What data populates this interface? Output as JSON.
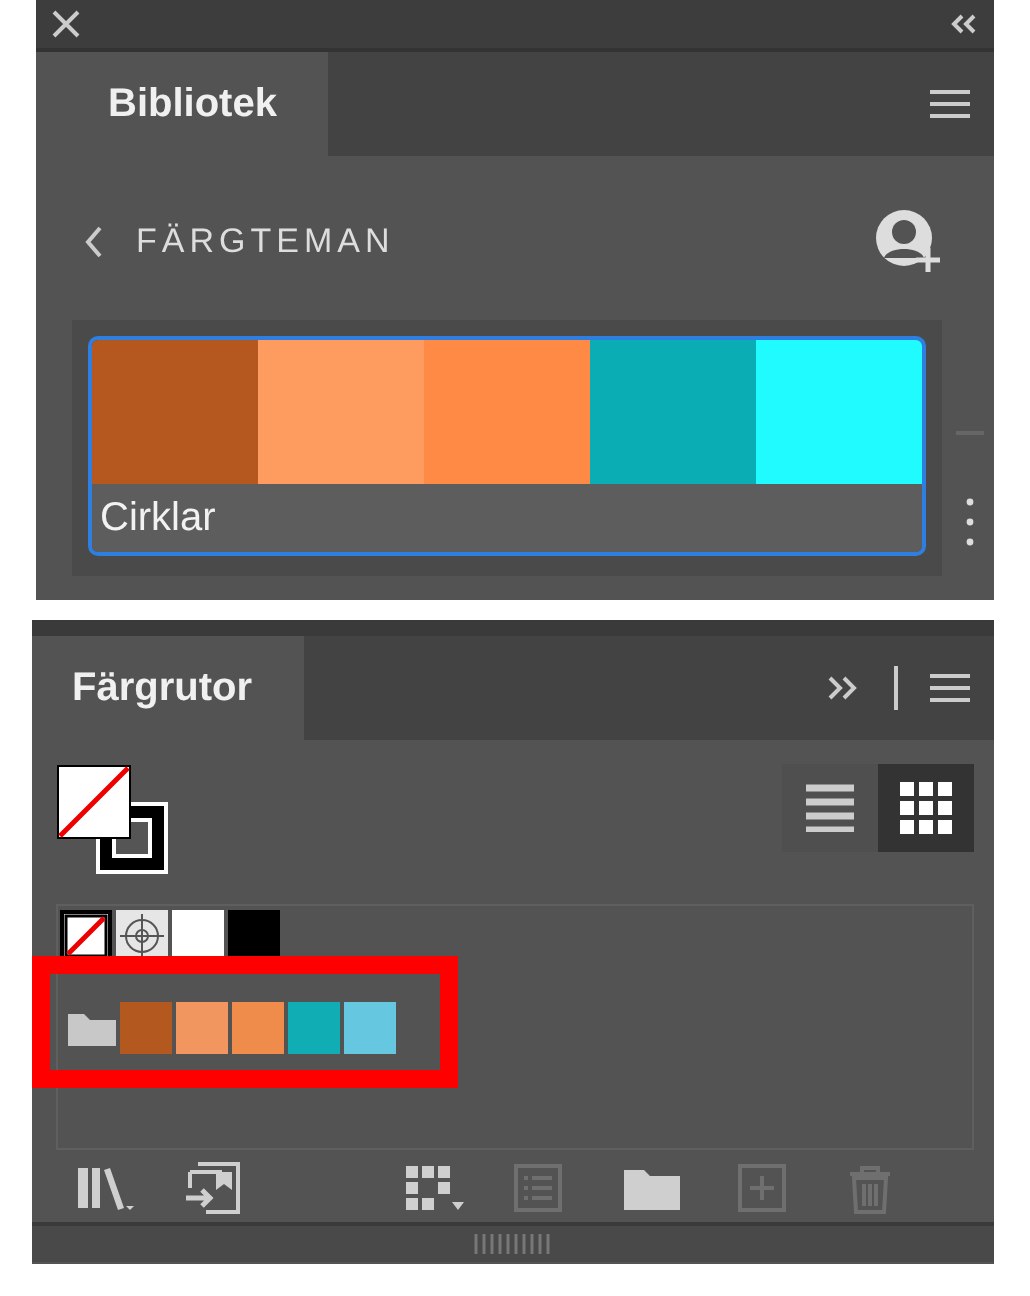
{
  "library_panel": {
    "tab": "Bibliotek",
    "section": "FÄRGTEMAN",
    "theme": {
      "name": "Cirklar",
      "selected": true,
      "colors": [
        {
          "color": "#b4581f"
        },
        {
          "color": "#fe9c60"
        },
        {
          "color": "#fe8a45"
        },
        {
          "color": "#0aadb4"
        },
        {
          "color": "#1ffbfe"
        }
      ]
    }
  },
  "swatches_panel": {
    "tab": "Färgrutor",
    "view_modes": [
      {
        "kind": "list",
        "selected": false
      },
      {
        "kind": "grid",
        "selected": true
      }
    ],
    "basic_swatches": [
      {
        "kind": "none"
      },
      {
        "kind": "registration"
      },
      {
        "kind": "color",
        "color": "#ffffff"
      },
      {
        "kind": "color",
        "color": "#000000"
      }
    ],
    "group": {
      "highlighted": true,
      "colors": [
        {
          "color": "#b3591f"
        },
        {
          "color": "#f0965e"
        },
        {
          "color": "#ef8c4c"
        },
        {
          "color": "#10adb4"
        },
        {
          "color": "#66c7e0"
        }
      ]
    },
    "toolbar": [
      {
        "kind": "libraries",
        "disabled": false
      },
      {
        "kind": "import",
        "disabled": false
      },
      {
        "kind": "swatch-kinds",
        "disabled": false
      },
      {
        "kind": "options",
        "disabled": true
      },
      {
        "kind": "folder",
        "disabled": false
      },
      {
        "kind": "add",
        "disabled": true
      },
      {
        "kind": "delete",
        "disabled": true
      }
    ]
  }
}
